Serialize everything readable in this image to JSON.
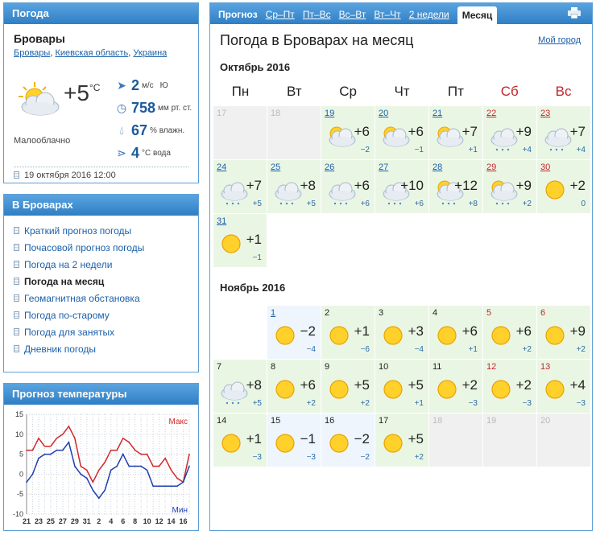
{
  "weather_panel": {
    "header": "Погода",
    "city": "Бровары",
    "crumbs": [
      "Бровары",
      "Киевская область",
      "Украина"
    ],
    "temp": "+5",
    "temp_unit": "°C",
    "condition": "Малооблачно",
    "wind_value": "2",
    "wind_unit": "м/с",
    "wind_dir": "Ю",
    "pressure_value": "758",
    "pressure_unit": "мм рт. ст.",
    "humidity_value": "67",
    "humidity_unit": "% влажн.",
    "water_value": "4",
    "water_unit": "°C вода",
    "date": "19 октября 2016 12:00"
  },
  "menu_panel": {
    "header": "В Броварах",
    "items": [
      {
        "label": "Краткий прогноз погоды",
        "current": false
      },
      {
        "label": "Почасовой прогноз погоды",
        "current": false
      },
      {
        "label": "Погода на 2 недели",
        "current": false
      },
      {
        "label": "Погода на месяц",
        "current": true
      },
      {
        "label": "Геомагнитная обстановка",
        "current": false
      },
      {
        "label": "Погода по-старому",
        "current": false
      },
      {
        "label": "Погода для занятых",
        "current": false
      },
      {
        "label": "Дневник погоды",
        "current": false
      }
    ]
  },
  "chart_panel": {
    "header": "Прогноз температуры"
  },
  "chart_data": {
    "type": "line",
    "x": [
      "21",
      "22",
      "23",
      "24",
      "25",
      "26",
      "27",
      "28",
      "29",
      "30",
      "31",
      "1",
      "2",
      "3",
      "4",
      "5",
      "6",
      "7",
      "8",
      "9",
      "10",
      "11",
      "12",
      "13",
      "14",
      "15",
      "16",
      "17"
    ],
    "xticks": [
      "21",
      "23",
      "25",
      "27",
      "29",
      "31",
      "2",
      "4",
      "6",
      "8",
      "10",
      "12",
      "14",
      "16"
    ],
    "ylim": [
      -10,
      15
    ],
    "yticks": [
      15,
      10,
      5,
      0,
      -5,
      -10
    ],
    "series": [
      {
        "name": "Макс",
        "color": "#d0282a",
        "values": [
          6,
          6,
          9,
          7,
          7,
          9,
          10,
          12,
          9,
          2,
          1,
          -2,
          1,
          3,
          6,
          6,
          9,
          8,
          6,
          5,
          5,
          2,
          2,
          4,
          1,
          -1,
          -2,
          5
        ]
      },
      {
        "name": "Мин",
        "color": "#1f3fb0",
        "values": [
          -2,
          0,
          4,
          5,
          5,
          6,
          6,
          8,
          2,
          0,
          -1,
          -4,
          -6,
          -4,
          1,
          2,
          5,
          2,
          2,
          2,
          1,
          -3,
          -3,
          -3,
          -3,
          -3,
          -2,
          2
        ]
      }
    ],
    "grid": true
  },
  "main": {
    "tabs": [
      {
        "label": "Прогноз",
        "kind": "first"
      },
      {
        "label": "Ср–Пт",
        "kind": "link"
      },
      {
        "label": "Пт–Вс",
        "kind": "link"
      },
      {
        "label": "Вс–Вт",
        "kind": "link"
      },
      {
        "label": "Вт–Чт",
        "kind": "link"
      },
      {
        "label": "2 недели",
        "kind": "link"
      },
      {
        "label": "Месяц",
        "kind": "active"
      }
    ],
    "title": "Погода в Броварах на месяц",
    "my_city": "Мой город",
    "weekdays": [
      "Пн",
      "Вт",
      "Ср",
      "Чт",
      "Пт",
      "Сб",
      "Вс"
    ],
    "months": [
      {
        "name": "Октябрь 2016",
        "days": [
          {
            "d": "17",
            "state": "past"
          },
          {
            "d": "18",
            "state": "past"
          },
          {
            "d": "19",
            "icon": "partly-cloudy",
            "hi": "+6",
            "lo": "−2",
            "link": true
          },
          {
            "d": "20",
            "icon": "partly-cloudy",
            "hi": "+6",
            "lo": "−1",
            "link": true
          },
          {
            "d": "21",
            "icon": "partly-cloudy",
            "hi": "+7",
            "lo": "+1",
            "link": true
          },
          {
            "d": "22",
            "icon": "cloudy-rain",
            "hi": "+9",
            "lo": "+4",
            "link": true,
            "we": true
          },
          {
            "d": "23",
            "icon": "cloudy-rain",
            "hi": "+7",
            "lo": "+4",
            "link": true,
            "we": true
          },
          {
            "d": "24",
            "icon": "cloudy-rain",
            "hi": "+7",
            "lo": "+5",
            "link": true
          },
          {
            "d": "25",
            "icon": "cloudy-rain",
            "hi": "+8",
            "lo": "+5",
            "link": true
          },
          {
            "d": "26",
            "icon": "cloudy-rain",
            "hi": "+6",
            "lo": "+6",
            "link": true
          },
          {
            "d": "27",
            "icon": "cloudy-rain",
            "hi": "+10",
            "lo": "+6",
            "link": true
          },
          {
            "d": "28",
            "icon": "partly-cloudy-rain",
            "hi": "+12",
            "lo": "+8",
            "link": true
          },
          {
            "d": "29",
            "icon": "partly-cloudy-rain",
            "hi": "+9",
            "lo": "+2",
            "link": true,
            "we": true
          },
          {
            "d": "30",
            "icon": "sun",
            "hi": "+2",
            "lo": "0",
            "link": true,
            "we": true
          },
          {
            "d": "31",
            "icon": "sun",
            "hi": "+1",
            "lo": "−1",
            "link": true
          }
        ]
      },
      {
        "name": "Ноябрь 2016",
        "lead": 1,
        "days": [
          {
            "d": "1",
            "icon": "sun",
            "hi": "−2",
            "lo": "−4",
            "link": true,
            "state": "today"
          },
          {
            "d": "2",
            "icon": "sun",
            "hi": "+1",
            "lo": "−6"
          },
          {
            "d": "3",
            "icon": "sun",
            "hi": "+3",
            "lo": "−4"
          },
          {
            "d": "4",
            "icon": "sun",
            "hi": "+6",
            "lo": "+1"
          },
          {
            "d": "5",
            "icon": "sun",
            "hi": "+6",
            "lo": "+2",
            "we": true
          },
          {
            "d": "6",
            "icon": "sun",
            "hi": "+9",
            "lo": "+2",
            "we": true
          },
          {
            "d": "7",
            "icon": "cloudy-rain",
            "hi": "+8",
            "lo": "+5"
          },
          {
            "d": "8",
            "icon": "sun",
            "hi": "+6",
            "lo": "+2"
          },
          {
            "d": "9",
            "icon": "sun",
            "hi": "+5",
            "lo": "+2"
          },
          {
            "d": "10",
            "icon": "sun",
            "hi": "+5",
            "lo": "+1"
          },
          {
            "d": "11",
            "icon": "sun",
            "hi": "+2",
            "lo": "−3"
          },
          {
            "d": "12",
            "icon": "sun",
            "hi": "+2",
            "lo": "−3",
            "we": true
          },
          {
            "d": "13",
            "icon": "sun",
            "hi": "+4",
            "lo": "−3",
            "we": true
          },
          {
            "d": "14",
            "icon": "sun",
            "hi": "+1",
            "lo": "−3"
          },
          {
            "d": "15",
            "icon": "sun",
            "hi": "−1",
            "lo": "−3",
            "state": "today"
          },
          {
            "d": "16",
            "icon": "sun",
            "hi": "−2",
            "lo": "−2",
            "state": "today"
          },
          {
            "d": "17",
            "icon": "sun",
            "hi": "+5",
            "lo": "+2"
          },
          {
            "d": "18",
            "state": "past"
          },
          {
            "d": "19",
            "state": "past"
          },
          {
            "d": "20",
            "state": "past"
          }
        ]
      }
    ]
  }
}
